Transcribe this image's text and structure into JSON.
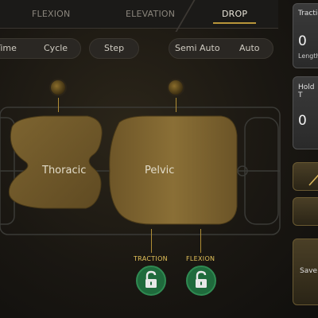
{
  "tabs": [
    {
      "label": "FLEXION"
    },
    {
      "label": "ELEVATION"
    },
    {
      "label": "DROP"
    }
  ],
  "active_tab": "DROP",
  "modes": {
    "left_group": {
      "time": "Time",
      "cycle": "Cycle"
    },
    "step": "Step",
    "right_group": {
      "semi_auto": "Semi Auto",
      "auto": "Auto"
    }
  },
  "table": {
    "thoracic": "Thoracic",
    "pelvic": "Pelvic"
  },
  "locks": {
    "traction": "TRACTION",
    "flexion": "FLEXION"
  },
  "side_panel": {
    "traction": {
      "label": "Tractio",
      "value": "0",
      "sub": "Length"
    },
    "hold": {
      "label": "Hold T",
      "value": "0"
    },
    "save_label": "Save"
  },
  "colors": {
    "accent_gold": "#b8953a",
    "lock_green": "#1f6a3c",
    "pad_gold": "#7a6230"
  }
}
